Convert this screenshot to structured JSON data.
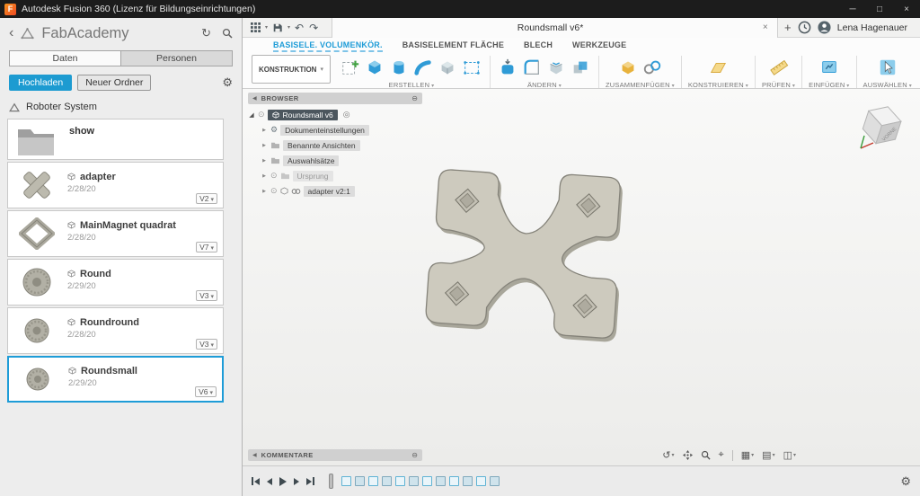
{
  "titlebar": {
    "app_title": "Autodesk Fusion 360 (Lizenz für Bildungseinrichtungen)",
    "logo_letter": "F"
  },
  "data_panel": {
    "title": "FabAcademy",
    "tabs": {
      "daten": "Daten",
      "personen": "Personen"
    },
    "upload_button": "Hochladen",
    "new_folder_button": "Neuer Ordner",
    "project_name": "Roboter System",
    "folder": {
      "name": "show"
    },
    "items": [
      {
        "name": "adapter",
        "date": "2/28/20",
        "version": "V2"
      },
      {
        "name": "MainMagnet quadrat",
        "date": "2/28/20",
        "version": "V7"
      },
      {
        "name": "Round",
        "date": "2/29/20",
        "version": "V3"
      },
      {
        "name": "Roundround",
        "date": "2/28/20",
        "version": "V3"
      },
      {
        "name": "Roundsmall",
        "date": "2/29/20",
        "version": "V6"
      }
    ]
  },
  "qat": {
    "document_tab": "Roundsmall v6*",
    "user_name": "Lena Hagenauer"
  },
  "ribbon": {
    "workspace_button": "KONSTRUKTION",
    "tabs": [
      {
        "label": "BASISELE. VOLUMENKÖR."
      },
      {
        "label": "BASISELEMENT FLÄCHE"
      },
      {
        "label": "BLECH"
      },
      {
        "label": "WERKZEUGE"
      }
    ],
    "groups": [
      "ERSTELLEN",
      "ÄNDERN",
      "ZUSAMMENFÜGEN",
      "KONSTRUIEREN",
      "PRÜFEN",
      "EINFÜGEN",
      "AUSWÄHLEN"
    ]
  },
  "browser": {
    "header": "BROWSER",
    "root_label": "Roundsmall v6",
    "items": [
      "Dokumenteinstellungen",
      "Benannte Ansichten",
      "Auswahlsätze",
      "Ursprung",
      "adapter v2:1"
    ]
  },
  "comments": {
    "header": "KOMMENTARE"
  },
  "viewcube": {
    "face_label": "VORNE"
  },
  "colors": {
    "accent": "#1e9cd7",
    "model_fill": "#cdcabe"
  },
  "icons": {
    "back": "‹",
    "refresh": "↻",
    "gear": "⚙",
    "minimize": "─",
    "maximize": "□",
    "close": "×",
    "undo": "↶",
    "redo": "↷",
    "tab_close": "×",
    "tab_add": "+",
    "orbit": "↺",
    "fit": "⌖",
    "display": "▦",
    "layout_grid": "▤",
    "viewports": "◫",
    "collapse": "◀",
    "detach": "⊖",
    "root_caret": "◢",
    "child_caret": "▶",
    "bulb": "⊙",
    "activate": "◎"
  }
}
